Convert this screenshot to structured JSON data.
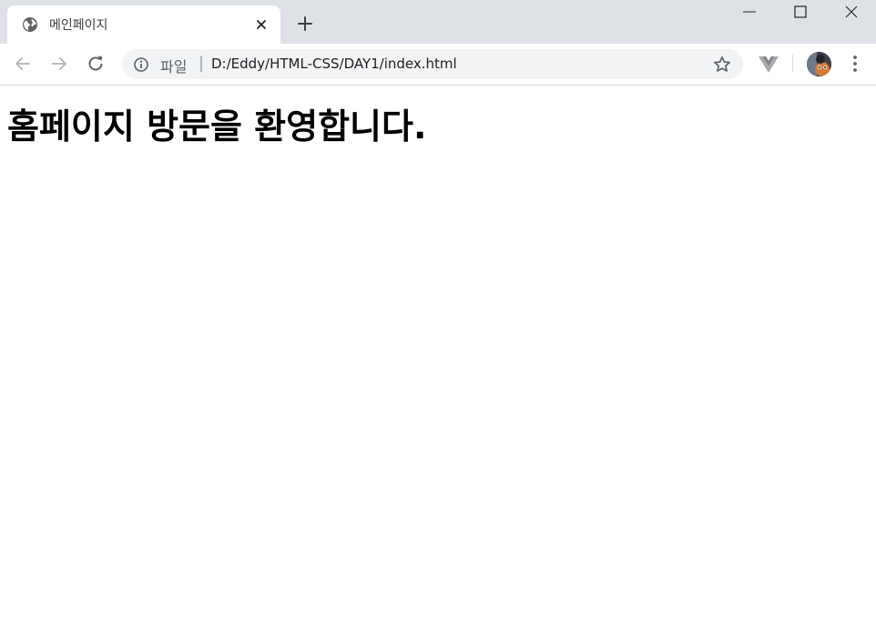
{
  "browser": {
    "tab": {
      "title": "메인페이지"
    },
    "address_bar": {
      "security_chip": "파일",
      "separator": "|",
      "url": "D:/Eddy/HTML-CSS/DAY1/index.html"
    }
  },
  "page": {
    "heading": "홈페이지 방문을 환영합니다."
  },
  "colors": {
    "tabstrip_bg": "#dee1e6",
    "omnibox_bg": "#f1f3f4",
    "icon_gray": "#5f6368",
    "disabled_gray": "#9aa0a6"
  },
  "icons": {
    "favicon": "globe-icon",
    "tab_close": "close-icon",
    "new_tab": "plus-icon",
    "minimize": "minimize-icon",
    "maximize": "maximize-icon",
    "window_close": "close-icon",
    "back": "arrow-left-icon",
    "forward": "arrow-right-icon",
    "reload": "reload-icon",
    "site_info": "info-icon",
    "bookmark": "star-icon",
    "extension": "vue-devtools-icon",
    "menu": "kebab-menu-icon"
  }
}
